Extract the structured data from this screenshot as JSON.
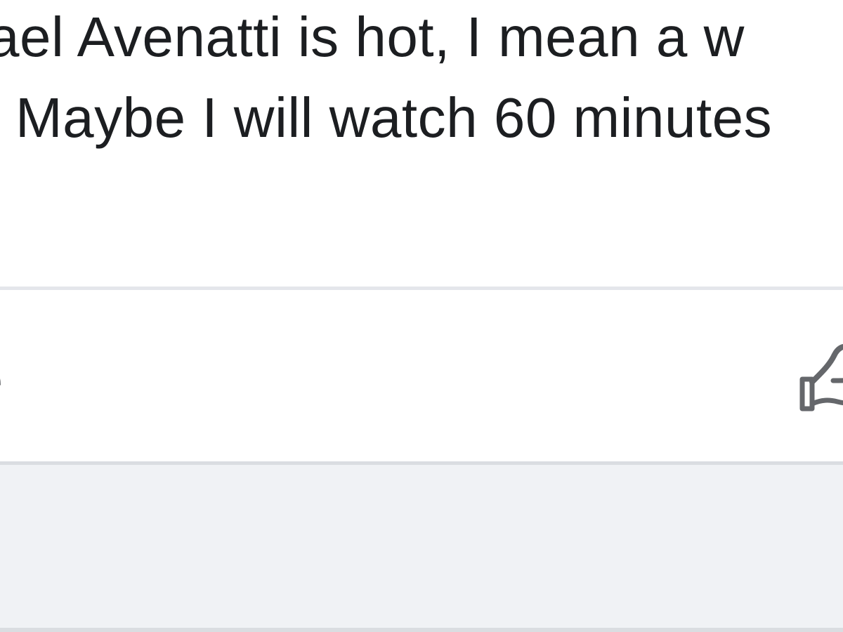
{
  "post": {
    "line1": "hael Avenatti is hot, I mean a w",
    "line2": "Maybe I will watch 60 minutes"
  },
  "actions": {
    "left_label_fragment": "e",
    "like_icon": "thumbs-up-icon"
  },
  "colors": {
    "text": "#1c1e21",
    "secondary_text": "#65676b",
    "divider": "#e4e6eb",
    "comment_background": "#f0f2f5"
  }
}
